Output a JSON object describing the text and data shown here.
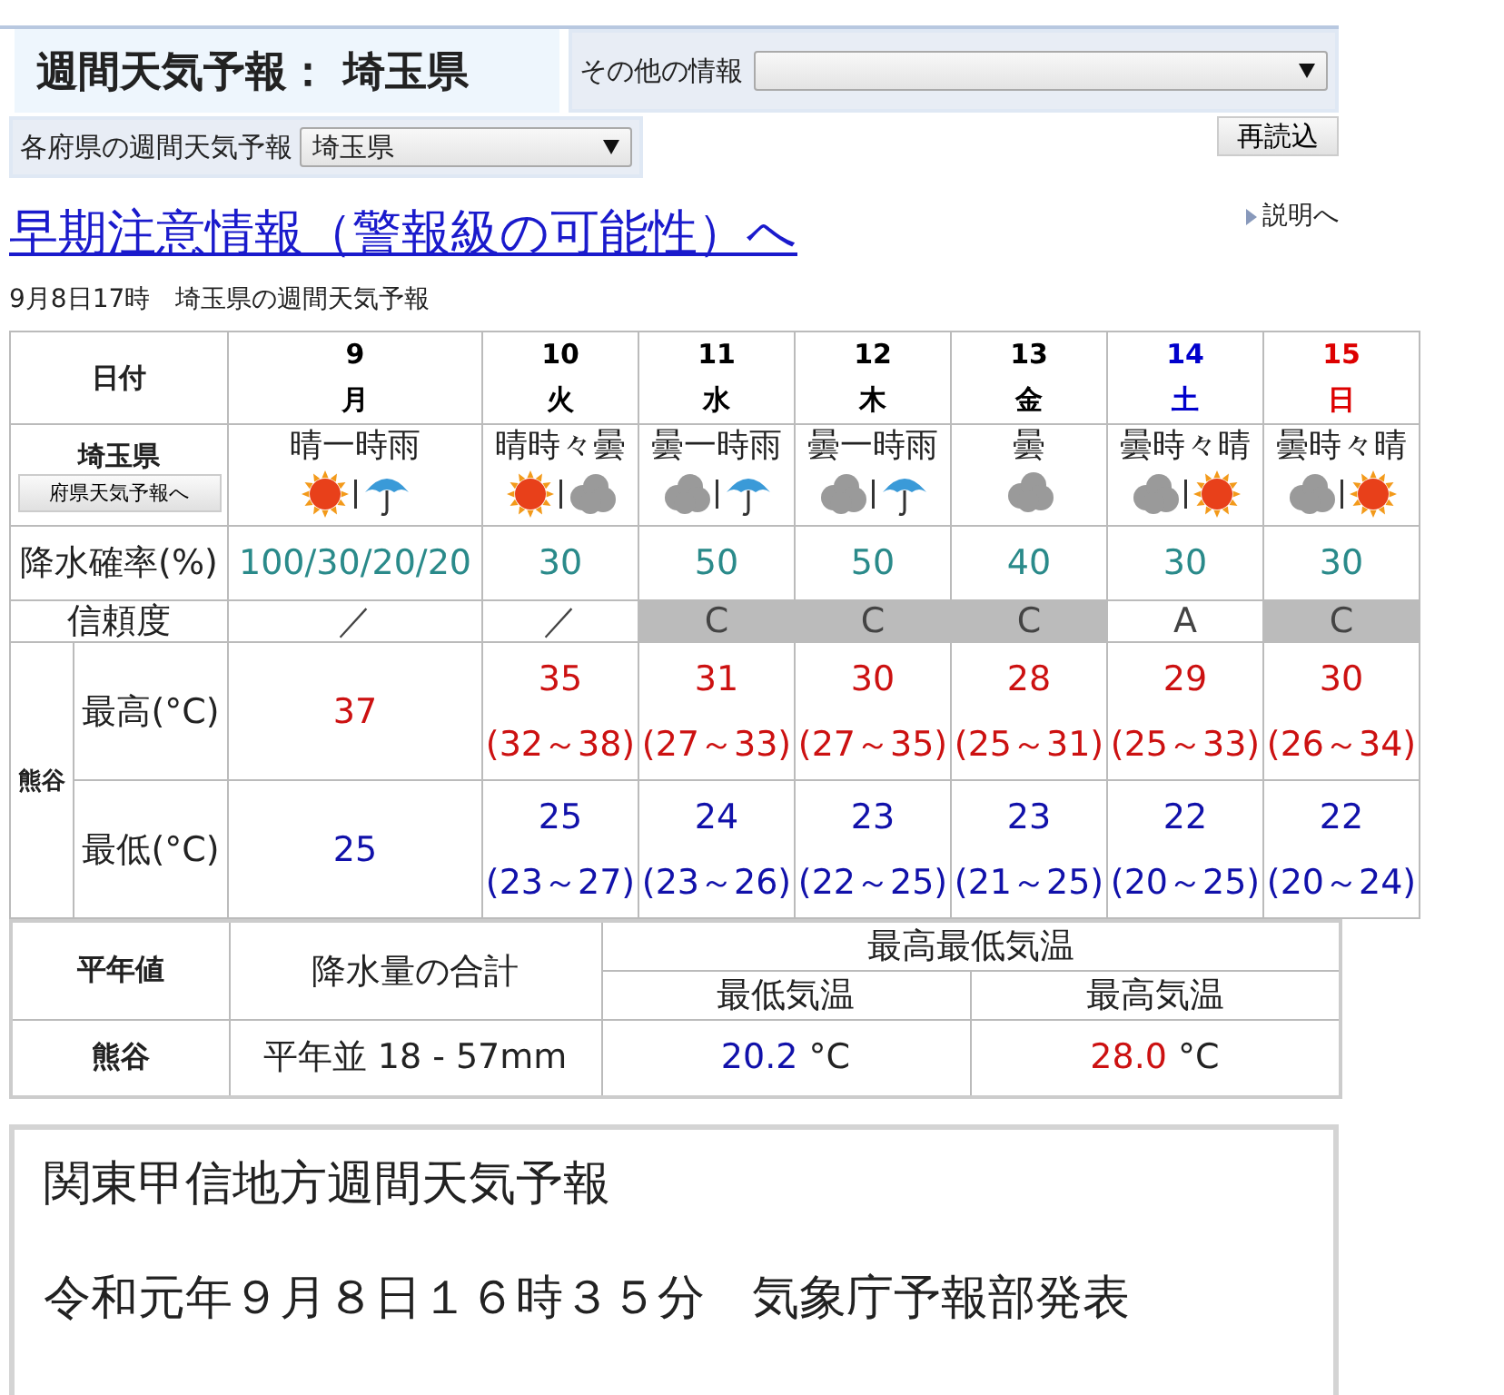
{
  "header": {
    "title": "週間天気予報： 埼玉県",
    "other_info_label": "その他の情報"
  },
  "prefecture_select": {
    "label": "各府県の週間天気予報",
    "value": "埼玉県"
  },
  "reload_button": "再読込",
  "early_warning_link": "早期注意情報（警報級の可能性）へ",
  "explanation_link": "説明へ",
  "issued": "9月8日17時　埼玉県の週間天気予報",
  "forecast": {
    "date_header": "日付",
    "region": "埼玉県",
    "region_button": "府県天気予報へ",
    "pop_label": "降水確率(%)",
    "reliability_label": "信頼度",
    "station": "熊谷",
    "max_label": "最高(°C)",
    "min_label": "最低(°C)",
    "days": [
      {
        "date": "9",
        "weekday": "月",
        "color": "#000000",
        "weather": "晴一時雨",
        "icons": [
          {
            "kind": "sun"
          },
          {
            "kind": "umbrella"
          }
        ],
        "pop": "100/30/20/20",
        "reliability": "／",
        "shaded": false,
        "max": "37",
        "min": "25"
      },
      {
        "date": "10",
        "weekday": "火",
        "color": "#000000",
        "weather": "晴時々曇",
        "icons": [
          {
            "kind": "sun"
          },
          {
            "kind": "cloud"
          }
        ],
        "pop": "30",
        "reliability": "／",
        "shaded": false,
        "max": "35",
        "max_range": "(32～38)",
        "min": "25",
        "min_range": "(23～27)"
      },
      {
        "date": "11",
        "weekday": "水",
        "color": "#000000",
        "weather": "曇一時雨",
        "icons": [
          {
            "kind": "cloud"
          },
          {
            "kind": "umbrella"
          }
        ],
        "pop": "50",
        "reliability": "C",
        "shaded": true,
        "max": "31",
        "max_range": "(27～33)",
        "min": "24",
        "min_range": "(23～26)"
      },
      {
        "date": "12",
        "weekday": "木",
        "color": "#000000",
        "weather": "曇一時雨",
        "icons": [
          {
            "kind": "cloud"
          },
          {
            "kind": "umbrella"
          }
        ],
        "pop": "50",
        "reliability": "C",
        "shaded": true,
        "max": "30",
        "max_range": "(27～35)",
        "min": "23",
        "min_range": "(22～25)"
      },
      {
        "date": "13",
        "weekday": "金",
        "color": "#000000",
        "weather": "曇",
        "icons": [
          {
            "kind": "cloud"
          }
        ],
        "pop": "40",
        "reliability": "C",
        "shaded": true,
        "max": "28",
        "max_range": "(25～31)",
        "min": "23",
        "min_range": "(21～25)"
      },
      {
        "date": "14",
        "weekday": "土",
        "color": "#0000cc",
        "weather": "曇時々晴",
        "icons": [
          {
            "kind": "cloud"
          },
          {
            "kind": "sun"
          }
        ],
        "pop": "30",
        "reliability": "A",
        "shaded": false,
        "max": "29",
        "max_range": "(25～33)",
        "min": "22",
        "min_range": "(20～25)"
      },
      {
        "date": "15",
        "weekday": "日",
        "color": "#dd0000",
        "weather": "曇時々晴",
        "icons": [
          {
            "kind": "cloud"
          },
          {
            "kind": "sun"
          }
        ],
        "pop": "30",
        "reliability": "C",
        "shaded": true,
        "max": "30",
        "max_range": "(26～34)",
        "min": "22",
        "min_range": "(20～24)"
      }
    ]
  },
  "normals": {
    "header": "平年値",
    "precip_header": "降水量の合計",
    "temp_header": "最高最低気温",
    "min_header": "最低気温",
    "max_header": "最高気温",
    "station": "熊谷",
    "precip": "平年並 18 - 57mm",
    "min_value": "20.2",
    "min_unit": "°C",
    "max_value": "28.0",
    "max_unit": "°C"
  },
  "bulletin": {
    "title": "関東甲信地方週間天気予報",
    "issued": "令和元年９月８日１６時３５分　気象庁予報部発表"
  }
}
